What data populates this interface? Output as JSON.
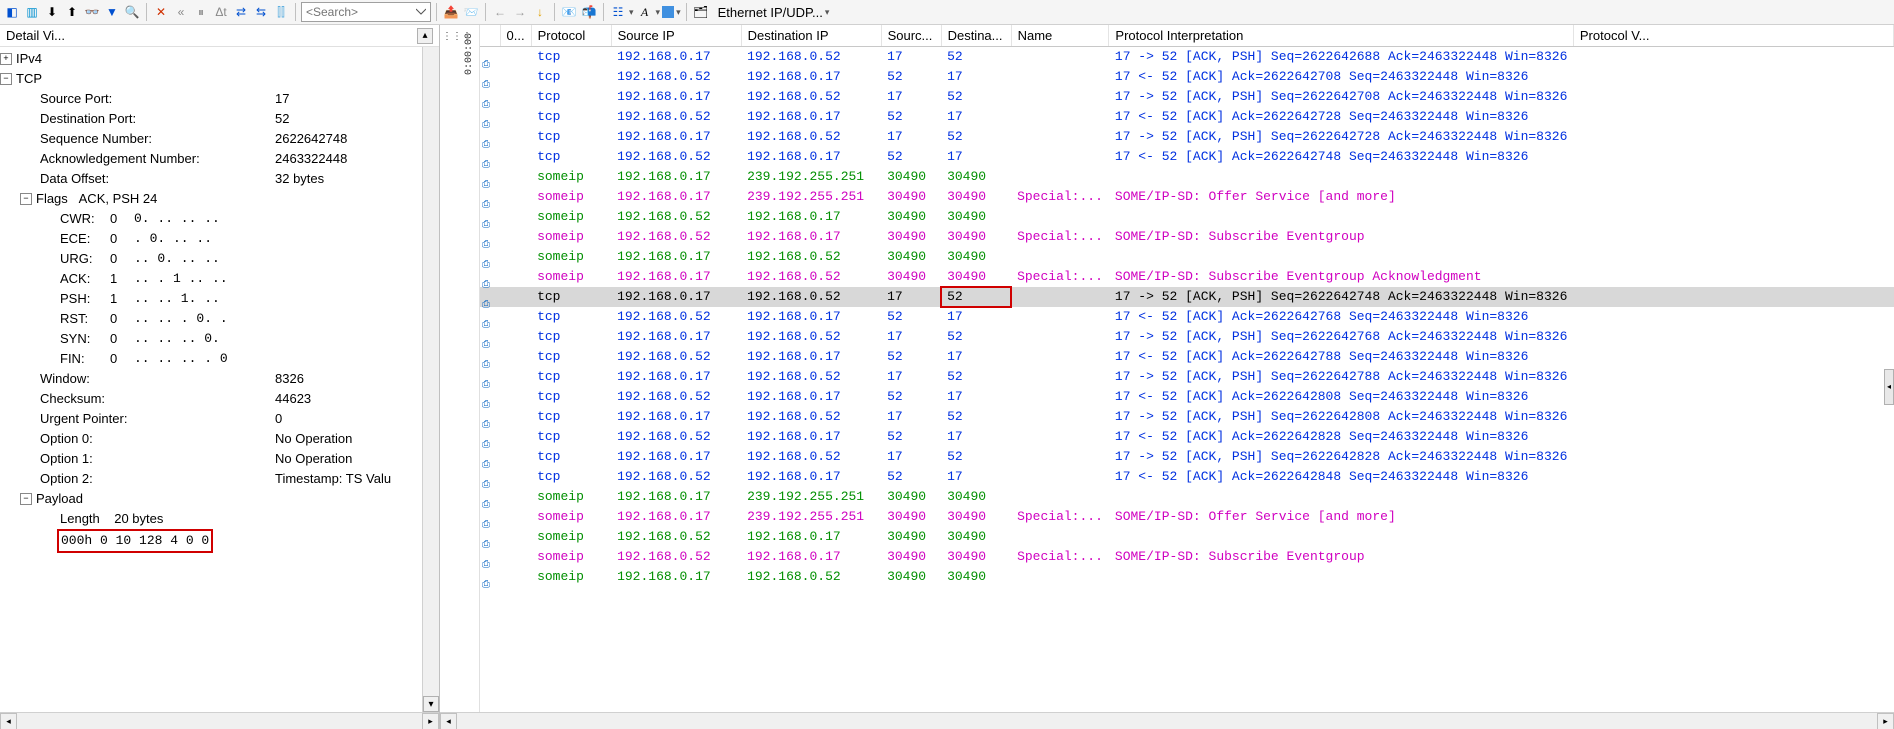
{
  "toolbar": {
    "search_placeholder": "<Search>",
    "config_label": "Ethernet IP/UDP..."
  },
  "detail": {
    "title": "Detail Vi...",
    "ipv4_label": "IPv4",
    "tcp_label": "TCP",
    "fields": {
      "src_port": {
        "label": "Source Port:",
        "value": "17"
      },
      "dst_port": {
        "label": "Destination Port:",
        "value": "52"
      },
      "seq": {
        "label": "Sequence Number:",
        "value": "2622642748"
      },
      "ack": {
        "label": "Acknowledgement Number:",
        "value": "2463322448"
      },
      "data_off": {
        "label": "Data Offset:",
        "value": "32 bytes"
      },
      "flags": {
        "label": "Flags",
        "value": "ACK, PSH   24"
      },
      "cwr": {
        "label": "CWR:",
        "v1": "0",
        "v2": "0. .. .. .."
      },
      "ece": {
        "label": "ECE:",
        "v1": "0",
        "v2": ". 0. .. .."
      },
      "urg": {
        "label": "URG:",
        "v1": "0",
        "v2": ".. 0. .. .."
      },
      "ackf": {
        "label": "ACK:",
        "v1": "1",
        "v2": ".. . 1 .. .."
      },
      "psh": {
        "label": "PSH:",
        "v1": "1",
        "v2": ".. .. 1. .."
      },
      "rst": {
        "label": "RST:",
        "v1": "0",
        "v2": ".. .. . 0. ."
      },
      "syn": {
        "label": "SYN:",
        "v1": "0",
        "v2": ".. .. .. 0."
      },
      "fin": {
        "label": "FIN:",
        "v1": "0",
        "v2": ".. .. .. . 0"
      },
      "window": {
        "label": "Window:",
        "value": "8326"
      },
      "checksum": {
        "label": "Checksum:",
        "value": "44623"
      },
      "urgptr": {
        "label": "Urgent Pointer:",
        "value": "0"
      },
      "opt0": {
        "label": "Option 0:",
        "value": "No Operation"
      },
      "opt1": {
        "label": "Option 1:",
        "value": "No Operation"
      },
      "opt2": {
        "label": "Option 2:",
        "value": "Timestamp: TS Valu"
      }
    },
    "payload": {
      "label": "Payload",
      "length_label": "Length",
      "length_value": "20 bytes",
      "hex_row": "000h          0    10  128       4       0       0"
    }
  },
  "grid": {
    "timeline_label": "0:00:00",
    "headers": {
      "idx": "0...",
      "proto": "Protocol",
      "src": "Source IP",
      "dst": "Destination IP",
      "sport": "Sourc...",
      "dport": "Destina...",
      "name": "Name",
      "interp": "Protocol Interpretation",
      "pval": "Protocol V..."
    },
    "rows": [
      {
        "cls": "blue",
        "proto": "tcp",
        "src": "192.168.0.17",
        "dst": "192.168.0.52",
        "sp": "17",
        "dp": "52",
        "name": "",
        "interp": "17 -> 52 [ACK, PSH] Seq=2622642688 Ack=2463322448 Win=8326"
      },
      {
        "cls": "blue",
        "proto": "tcp",
        "src": "192.168.0.52",
        "dst": "192.168.0.17",
        "sp": "52",
        "dp": "17",
        "name": "",
        "interp": "17 <- 52 [ACK] Ack=2622642708 Seq=2463322448 Win=8326"
      },
      {
        "cls": "blue",
        "proto": "tcp",
        "src": "192.168.0.17",
        "dst": "192.168.0.52",
        "sp": "17",
        "dp": "52",
        "name": "",
        "interp": "17 -> 52 [ACK, PSH] Seq=2622642708 Ack=2463322448 Win=8326"
      },
      {
        "cls": "blue",
        "proto": "tcp",
        "src": "192.168.0.52",
        "dst": "192.168.0.17",
        "sp": "52",
        "dp": "17",
        "name": "",
        "interp": "17 <- 52 [ACK] Ack=2622642728 Seq=2463322448 Win=8326"
      },
      {
        "cls": "blue",
        "proto": "tcp",
        "src": "192.168.0.17",
        "dst": "192.168.0.52",
        "sp": "17",
        "dp": "52",
        "name": "",
        "interp": "17 -> 52 [ACK, PSH] Seq=2622642728 Ack=2463322448 Win=8326"
      },
      {
        "cls": "blue",
        "proto": "tcp",
        "src": "192.168.0.52",
        "dst": "192.168.0.17",
        "sp": "52",
        "dp": "17",
        "name": "",
        "interp": "17 <- 52 [ACK] Ack=2622642748 Seq=2463322448 Win=8326"
      },
      {
        "cls": "green",
        "proto": "someip",
        "src": "192.168.0.17",
        "dst": "239.192.255.251",
        "sp": "30490",
        "dp": "30490",
        "name": "",
        "interp": ""
      },
      {
        "cls": "mag",
        "proto": "someip",
        "src": "192.168.0.17",
        "dst": "239.192.255.251",
        "sp": "30490",
        "dp": "30490",
        "name": "Special:...",
        "interp": "SOME/IP-SD: Offer Service [and more]"
      },
      {
        "cls": "green",
        "proto": "someip",
        "src": "192.168.0.52",
        "dst": "192.168.0.17",
        "sp": "30490",
        "dp": "30490",
        "name": "",
        "interp": ""
      },
      {
        "cls": "mag",
        "proto": "someip",
        "src": "192.168.0.52",
        "dst": "192.168.0.17",
        "sp": "30490",
        "dp": "30490",
        "name": "Special:...",
        "interp": "SOME/IP-SD: Subscribe Eventgroup"
      },
      {
        "cls": "green",
        "proto": "someip",
        "src": "192.168.0.17",
        "dst": "192.168.0.52",
        "sp": "30490",
        "dp": "30490",
        "name": "",
        "interp": ""
      },
      {
        "cls": "mag",
        "proto": "someip",
        "src": "192.168.0.17",
        "dst": "192.168.0.52",
        "sp": "30490",
        "dp": "30490",
        "name": "Special:...",
        "interp": "SOME/IP-SD: Subscribe Eventgroup Acknowledgment"
      },
      {
        "cls": "blue",
        "sel": true,
        "proto": "tcp",
        "src": "192.168.0.17",
        "dst": "192.168.0.52",
        "sp": "17",
        "dp": "52",
        "dp_box": true,
        "name": "",
        "interp": "17 -> 52 [ACK, PSH] Seq=2622642748 Ack=2463322448 Win=8326"
      },
      {
        "cls": "blue",
        "proto": "tcp",
        "src": "192.168.0.52",
        "dst": "192.168.0.17",
        "sp": "52",
        "dp": "17",
        "name": "",
        "interp": "17 <- 52 [ACK] Ack=2622642768 Seq=2463322448 Win=8326"
      },
      {
        "cls": "blue",
        "proto": "tcp",
        "src": "192.168.0.17",
        "dst": "192.168.0.52",
        "sp": "17",
        "dp": "52",
        "name": "",
        "interp": "17 -> 52 [ACK, PSH] Seq=2622642768 Ack=2463322448 Win=8326"
      },
      {
        "cls": "blue",
        "proto": "tcp",
        "src": "192.168.0.52",
        "dst": "192.168.0.17",
        "sp": "52",
        "dp": "17",
        "name": "",
        "interp": "17 <- 52 [ACK] Ack=2622642788 Seq=2463322448 Win=8326"
      },
      {
        "cls": "blue",
        "proto": "tcp",
        "src": "192.168.0.17",
        "dst": "192.168.0.52",
        "sp": "17",
        "dp": "52",
        "name": "",
        "interp": "17 -> 52 [ACK, PSH] Seq=2622642788 Ack=2463322448 Win=8326"
      },
      {
        "cls": "blue",
        "proto": "tcp",
        "src": "192.168.0.52",
        "dst": "192.168.0.17",
        "sp": "52",
        "dp": "17",
        "name": "",
        "interp": "17 <- 52 [ACK] Ack=2622642808 Seq=2463322448 Win=8326"
      },
      {
        "cls": "blue",
        "proto": "tcp",
        "src": "192.168.0.17",
        "dst": "192.168.0.52",
        "sp": "17",
        "dp": "52",
        "name": "",
        "interp": "17 -> 52 [ACK, PSH] Seq=2622642808 Ack=2463322448 Win=8326"
      },
      {
        "cls": "blue",
        "proto": "tcp",
        "src": "192.168.0.52",
        "dst": "192.168.0.17",
        "sp": "52",
        "dp": "17",
        "name": "",
        "interp": "17 <- 52 [ACK] Ack=2622642828 Seq=2463322448 Win=8326"
      },
      {
        "cls": "blue",
        "proto": "tcp",
        "src": "192.168.0.17",
        "dst": "192.168.0.52",
        "sp": "17",
        "dp": "52",
        "name": "",
        "interp": "17 -> 52 [ACK, PSH] Seq=2622642828 Ack=2463322448 Win=8326"
      },
      {
        "cls": "blue",
        "proto": "tcp",
        "src": "192.168.0.52",
        "dst": "192.168.0.17",
        "sp": "52",
        "dp": "17",
        "name": "",
        "interp": "17 <- 52 [ACK] Ack=2622642848 Seq=2463322448 Win=8326"
      },
      {
        "cls": "green",
        "proto": "someip",
        "src": "192.168.0.17",
        "dst": "239.192.255.251",
        "sp": "30490",
        "dp": "30490",
        "name": "",
        "interp": ""
      },
      {
        "cls": "mag",
        "proto": "someip",
        "src": "192.168.0.17",
        "dst": "239.192.255.251",
        "sp": "30490",
        "dp": "30490",
        "name": "Special:...",
        "interp": "SOME/IP-SD: Offer Service [and more]"
      },
      {
        "cls": "green",
        "proto": "someip",
        "src": "192.168.0.52",
        "dst": "192.168.0.17",
        "sp": "30490",
        "dp": "30490",
        "name": "",
        "interp": ""
      },
      {
        "cls": "mag",
        "proto": "someip",
        "src": "192.168.0.52",
        "dst": "192.168.0.17",
        "sp": "30490",
        "dp": "30490",
        "name": "Special:...",
        "interp": "SOME/IP-SD: Subscribe Eventgroup"
      },
      {
        "cls": "green",
        "proto": "someip",
        "src": "192.168.0.17",
        "dst": "192.168.0.52",
        "sp": "30490",
        "dp": "30490",
        "name": "",
        "interp": ""
      }
    ]
  }
}
